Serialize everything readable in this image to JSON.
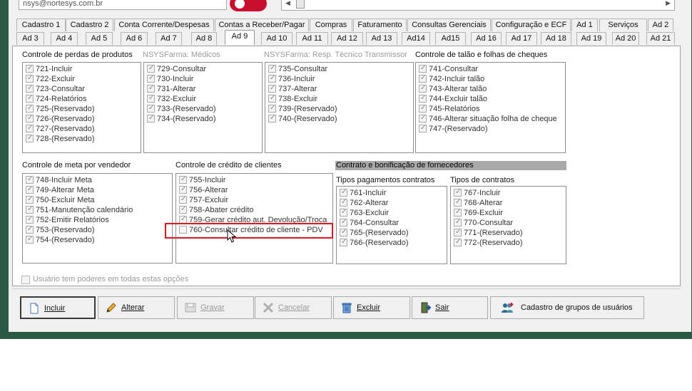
{
  "header": {
    "email": "nsys@nortesys.com.br"
  },
  "tabs_row1": [
    {
      "label": "Cadastro 1"
    },
    {
      "label": "Cadastro 2"
    },
    {
      "label": "Conta Corrente/Despesas"
    },
    {
      "label": "Contas a Receber/Pagar"
    },
    {
      "label": "Compras"
    },
    {
      "label": "Faturamento"
    },
    {
      "label": "Consultas Gerenciais"
    },
    {
      "label": "Configuração e ECF"
    },
    {
      "label": "Ad 1"
    },
    {
      "label": "Serviços"
    },
    {
      "label": "Ad 2"
    }
  ],
  "tabs_row2": [
    {
      "label": "Ad 3"
    },
    {
      "label": "Ad 4"
    },
    {
      "label": "Ad 5"
    },
    {
      "label": "Ad 6"
    },
    {
      "label": "Ad 7"
    },
    {
      "label": "Ad 8"
    },
    {
      "label": "Ad 9"
    },
    {
      "label": "Ad 10"
    },
    {
      "label": "Ad 11"
    },
    {
      "label": "Ad 12"
    },
    {
      "label": "Ad 13"
    },
    {
      "label": "Ad14"
    },
    {
      "label": "Ad15"
    },
    {
      "label": "Ad 16"
    },
    {
      "label": "Ad 17"
    },
    {
      "label": "Ad 18"
    },
    {
      "label": "Ad 19"
    },
    {
      "label": "Ad 20"
    },
    {
      "label": "Ad 21"
    }
  ],
  "active_tab": "Ad 9",
  "groups": {
    "perdas": {
      "title": "Controle de perdas de produtos",
      "items": [
        {
          "label": "721-Incluir",
          "checked": true
        },
        {
          "label": "722-Excluir",
          "checked": true
        },
        {
          "label": "723-Consultar",
          "checked": true
        },
        {
          "label": "724-Relatórios",
          "checked": true
        },
        {
          "label": "725-(Reservado)",
          "checked": true
        },
        {
          "label": "726-(Reservado)",
          "checked": true
        },
        {
          "label": "727-(Reservado)",
          "checked": true
        },
        {
          "label": "728-(Reservado)",
          "checked": true
        }
      ]
    },
    "medicos": {
      "title": "NSYSFarma: Médicos",
      "items": [
        {
          "label": "729-Consultar",
          "checked": true
        },
        {
          "label": "730-Incluir",
          "checked": true
        },
        {
          "label": "731-Alterar",
          "checked": true
        },
        {
          "label": "732-Excluir",
          "checked": true
        },
        {
          "label": "733-(Reservado)",
          "checked": true
        },
        {
          "label": "734-(Reservado)",
          "checked": true
        }
      ]
    },
    "resp": {
      "title": "NSYSFarma: Resp. Técnico Transmissor",
      "items": [
        {
          "label": "735-Consultar",
          "checked": true
        },
        {
          "label": "736-Incluir",
          "checked": true
        },
        {
          "label": "737-Alterar",
          "checked": true
        },
        {
          "label": "738-Excluir",
          "checked": true
        },
        {
          "label": "739-(Reservado)",
          "checked": true
        },
        {
          "label": "740-(Reservado)",
          "checked": true
        }
      ]
    },
    "talao": {
      "title": "Controle de talão e folhas de cheques",
      "items": [
        {
          "label": "741-Consultar",
          "checked": true
        },
        {
          "label": "742-Incluir talão",
          "checked": true
        },
        {
          "label": "743-Alterar talão",
          "checked": true
        },
        {
          "label": "744-Excluir talão",
          "checked": true
        },
        {
          "label": "745-Relatórios",
          "checked": true
        },
        {
          "label": "746-Alterar situação folha de cheque",
          "checked": true
        },
        {
          "label": "747-(Reservado)",
          "checked": true
        }
      ]
    },
    "meta": {
      "title": "Controle de meta por vendedor",
      "items": [
        {
          "label": "748-Incluir Meta",
          "checked": true
        },
        {
          "label": "749-Alterar Meta",
          "checked": true
        },
        {
          "label": "750-Excluir Meta",
          "checked": true
        },
        {
          "label": "751-Manutenção calendário",
          "checked": true
        },
        {
          "label": "752-Emitir Relatórios",
          "checked": true
        },
        {
          "label": "753-(Reservado)",
          "checked": true
        },
        {
          "label": "754-(Reservado)",
          "checked": true
        }
      ]
    },
    "credito": {
      "title": "Controle de crédito de clientes",
      "items": [
        {
          "label": "755-Incluir",
          "checked": true
        },
        {
          "label": "756-Alterar",
          "checked": true
        },
        {
          "label": "757-Excluir",
          "checked": true
        },
        {
          "label": "758-Abater crédito",
          "checked": true
        },
        {
          "label": "759-Gerar crédito aut. Devolução/Troca",
          "checked": true
        },
        {
          "label": "760-Consultar crédito de cliente - PDV",
          "checked": false
        }
      ]
    },
    "contrato_title": "Contrato e bonificação de fornecedores",
    "tipos_pag": {
      "title": "Tipos pagamentos contratos",
      "items": [
        {
          "label": "761-Incluir",
          "checked": true
        },
        {
          "label": "762-Alterar",
          "checked": true
        },
        {
          "label": "763-Excluir",
          "checked": true
        },
        {
          "label": "764-Consultar",
          "checked": true
        },
        {
          "label": "765-(Reservado)",
          "checked": true
        },
        {
          "label": "766-(Reservado)",
          "checked": true
        }
      ]
    },
    "tipos_con": {
      "title": "Tipos de contratos",
      "items": [
        {
          "label": "767-Incluir",
          "checked": true
        },
        {
          "label": "768-Alterar",
          "checked": true
        },
        {
          "label": "769-Excluir",
          "checked": true
        },
        {
          "label": "770-Consultar",
          "checked": true
        },
        {
          "label": "771-(Reservado)",
          "checked": true
        },
        {
          "label": "772-(Reservado)",
          "checked": true
        }
      ]
    }
  },
  "all_options_label": "Usuário tem poderes em todas estas opções",
  "buttons": {
    "incluir": "Incluir",
    "alterar": "Alterar",
    "gravar": "Gravar",
    "cancelar": "Cancelar",
    "excluir": "Excluir",
    "sair": "Sair",
    "grupos": "Cadastro de grupos de usuários"
  },
  "colors": {
    "frame": "#2b5a44",
    "highlight": "#e0151f",
    "toggle": "#c8102e"
  }
}
